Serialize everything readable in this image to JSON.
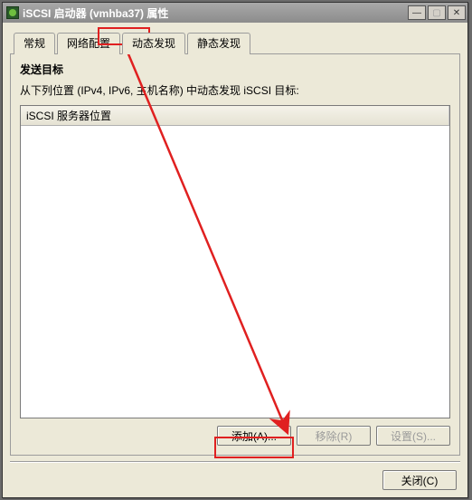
{
  "window": {
    "title": "iSCSI 启动器 (vmhba37) 属性"
  },
  "tabs": [
    {
      "label": "常规"
    },
    {
      "label": "网络配置"
    },
    {
      "label": "动态发现"
    },
    {
      "label": "静态发现"
    }
  ],
  "active_tab_index": 2,
  "panel": {
    "title": "发送目标",
    "description": "从下列位置 (IPv4, IPv6, 主机名称) 中动态发现 iSCSI 目标:"
  },
  "list": {
    "columns": [
      {
        "header": "iSCSI 服务器位置"
      }
    ],
    "rows": []
  },
  "buttons": {
    "add": "添加(A)...",
    "remove": "移除(R)",
    "settings": "设置(S)...",
    "close": "关闭(C)"
  },
  "annotation": {
    "color": "#e02020",
    "highlight_tab_index": 2,
    "highlight_button": "add"
  }
}
